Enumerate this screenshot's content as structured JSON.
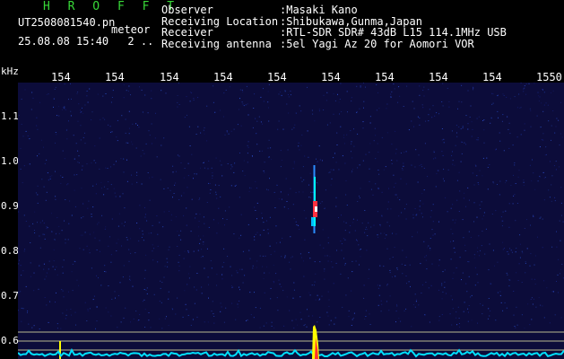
{
  "header": {
    "logo": "H R O F F T",
    "filename": "UT2508081540.pn",
    "app_name": "meteor",
    "datetime": "25.08.08 15:40",
    "extra": "2 ..",
    "labels": [
      "Observer",
      "Receiving Location",
      "Receiver",
      "Receiving antenna"
    ],
    "values": [
      ":Masaki Kano",
      ":Shibukawa,Gunma,Japan",
      ":RTL-SDR SDR# 43dB L15 114.1MHz USB",
      ":5el Yagi Az 20 for Aomori VOR"
    ]
  },
  "axes": {
    "freq_unit": "kHz",
    "freq_ticks": [
      "154",
      "154",
      "154",
      "154",
      "154",
      "154",
      "154",
      "154",
      "154",
      "1550"
    ],
    "y_ticks": [
      "1.1",
      "1.0",
      "0.9",
      "0.8",
      "0.7",
      "0.6"
    ]
  },
  "colors": {
    "header_green": "#38d838",
    "background": "#0c0c3a",
    "noise_blue": "#2040b0",
    "signal_cyan": "#00ffff",
    "signal_red": "#ff3040",
    "baseline_yellow": "#ffff00",
    "guide_lines": "#b8b890"
  }
}
